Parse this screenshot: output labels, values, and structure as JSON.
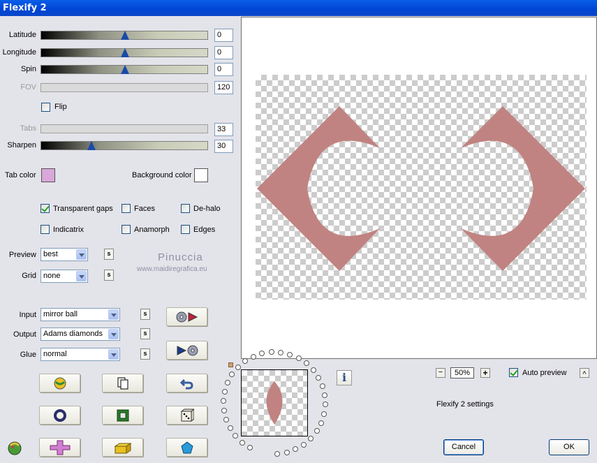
{
  "window": {
    "title": "Flexify 2"
  },
  "sliders": [
    {
      "id": "latitude",
      "label": "Latitude",
      "value": "0",
      "pos": 0.5,
      "disabled": false
    },
    {
      "id": "longitude",
      "label": "Longitude",
      "value": "0",
      "pos": 0.5,
      "disabled": false
    },
    {
      "id": "spin",
      "label": "Spin",
      "value": "0",
      "pos": 0.5,
      "disabled": false
    },
    {
      "id": "fov",
      "label": "FOV",
      "value": "120",
      "pos": 0,
      "disabled": true
    },
    {
      "id": "tabs",
      "label": "Tabs",
      "value": "33",
      "pos": 0,
      "disabled": true
    },
    {
      "id": "sharpen",
      "label": "Sharpen",
      "value": "30",
      "pos": 0.3,
      "disabled": false
    }
  ],
  "flip": {
    "label": "Flip",
    "checked": false
  },
  "colors": {
    "tab_label": "Tab color",
    "tab_value": "#d9a7d9",
    "bg_label": "Background color",
    "bg_value": "#ffffff",
    "shape": "#c08381"
  },
  "options": {
    "transparent_gaps": {
      "label": "Transparent gaps",
      "checked": true
    },
    "faces": {
      "label": "Faces",
      "checked": false
    },
    "de_halo": {
      "label": "De-halo",
      "checked": false
    },
    "indicatrix": {
      "label": "Indicatrix",
      "checked": false
    },
    "anamorph": {
      "label": "Anamorph",
      "checked": false
    },
    "edges": {
      "label": "Edges",
      "checked": false
    }
  },
  "preview_select": {
    "label": "Preview",
    "value": "best"
  },
  "grid_select": {
    "label": "Grid",
    "value": "none"
  },
  "input_select": {
    "label": "Input",
    "value": "mirror ball"
  },
  "output_select": {
    "label": "Output",
    "value": "Adams diamonds"
  },
  "glue_select": {
    "label": "Glue",
    "value": "normal"
  },
  "small_button_label": "s",
  "watermark": {
    "name": "Pinuccia",
    "url": "www.maidiregrafica.eu"
  },
  "zoom": {
    "value": "50%",
    "minus": "−",
    "plus": "+"
  },
  "auto_preview": {
    "label": "Auto preview",
    "checked": true
  },
  "collapse_label": "^",
  "settings_label": "Flexify 2 settings",
  "info_label": "i",
  "buttons": {
    "cancel": "Cancel",
    "ok": "OK"
  }
}
